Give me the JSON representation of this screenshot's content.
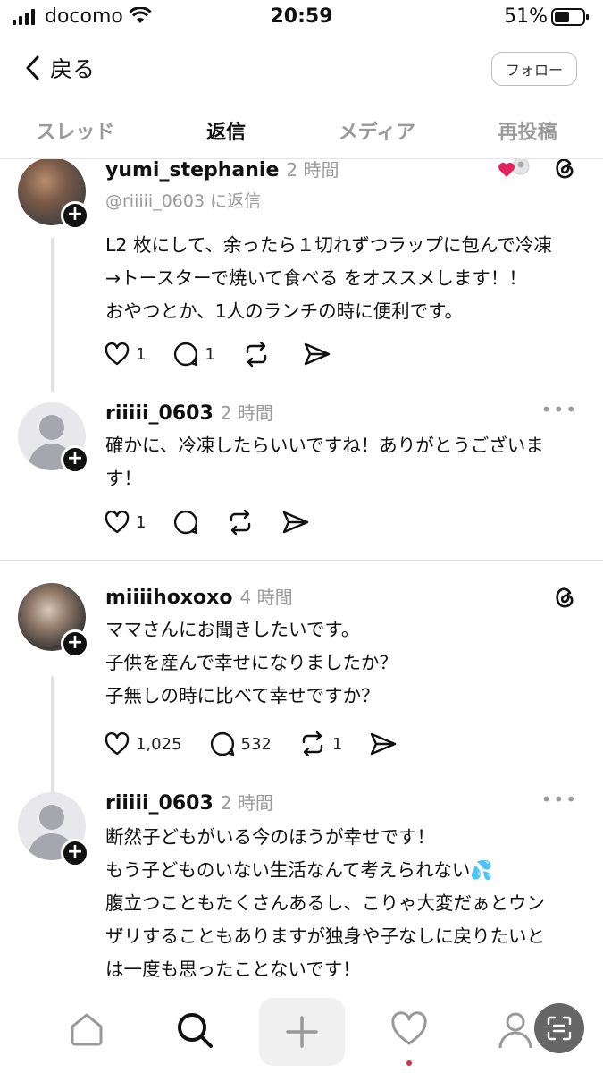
{
  "status_bar": {
    "carrier": "docomo",
    "time": "20:59",
    "battery": "51%"
  },
  "nav": {
    "back_label": "戻る",
    "follow_label": "フォロー"
  },
  "tabs": [
    {
      "label": "スレッド",
      "active": false
    },
    {
      "label": "返信",
      "active": true
    },
    {
      "label": "メディア",
      "active": false
    },
    {
      "label": "再投稿",
      "active": false
    }
  ],
  "posts": [
    {
      "username": "yumi_stephanie",
      "time": "2 時間",
      "reply_to": "@riiiii_0603 に返信",
      "lines": [
        "L2 枚にして、余ったら１切れずつラップに包んで冷凍",
        "→トースターで焼いて食べる をオススメします！！",
        "おやつとか、1人のランチの時に便利です。"
      ],
      "likes": "1",
      "replies": "1",
      "reposts": ""
    },
    {
      "username": "riiiii_0603",
      "time": "2 時間",
      "lines": [
        "確かに、冷凍したらいいですね！ありがとうございま",
        "す！"
      ],
      "likes": "1",
      "replies": "",
      "reposts": ""
    },
    {
      "username": "miiiihoxoxo",
      "time": "4 時間",
      "lines": [
        "ママさんにお聞きしたいです。",
        "子供を産んで幸せになりましたか？",
        "子無しの時に比べて幸せですか？"
      ],
      "likes": "1,025",
      "replies": "532",
      "reposts": "1"
    },
    {
      "username": "riiiii_0603",
      "time": "2 時間",
      "lines": [
        "断然子どもがいる今のほうが幸せです！",
        "もう子どものいない生活なんて考えられない💦",
        "腹立つこともたくさんあるし、こりゃ大変だぁとウン",
        "ザリすることもありますが独身や子なしに戻りたいと",
        "は一度も思ったことないです！"
      ]
    }
  ],
  "icons": {
    "like": "heart-icon",
    "reply": "comment-icon",
    "repost": "repost-icon",
    "share": "send-icon",
    "threads": "threads-logo-icon"
  },
  "colors": {
    "accent_like": "#e0245e",
    "muted": "#9a9a9a"
  }
}
